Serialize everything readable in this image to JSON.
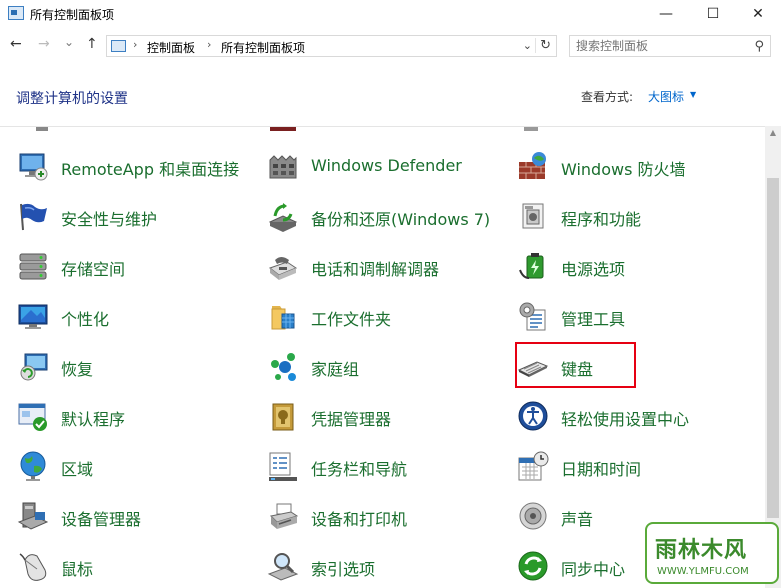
{
  "window": {
    "title": "所有控制面板项",
    "minimize": "—",
    "maximize": "☐",
    "close": "✕"
  },
  "nav": {
    "back": "←",
    "forward": "→",
    "recent": "⌄",
    "up": "↑",
    "breadcrumb": [
      "控制面板",
      "所有控制面板项"
    ],
    "crumb_sep": "›",
    "dropdown": "⌄",
    "refresh": "↻"
  },
  "search": {
    "placeholder": "搜索控制面板",
    "icon": "⚲"
  },
  "header": {
    "title": "调整计算机的设置",
    "view_label": "查看方式:",
    "view_value": "大图标",
    "view_arrow": "▼"
  },
  "items": [
    {
      "label": "RemoteApp 和桌面连接",
      "icon": "remoteapp-icon"
    },
    {
      "label": "Windows Defender",
      "icon": "windows-defender-icon"
    },
    {
      "label": "Windows 防火墙",
      "icon": "firewall-icon"
    },
    {
      "label": "安全性与维护",
      "icon": "security-flag-icon"
    },
    {
      "label": "备份和还原(Windows 7)",
      "icon": "backup-restore-icon"
    },
    {
      "label": "程序和功能",
      "icon": "programs-icon"
    },
    {
      "label": "存储空间",
      "icon": "storage-spaces-icon"
    },
    {
      "label": "电话和调制解调器",
      "icon": "phone-modem-icon"
    },
    {
      "label": "电源选项",
      "icon": "power-options-icon"
    },
    {
      "label": "个性化",
      "icon": "personalization-icon"
    },
    {
      "label": "工作文件夹",
      "icon": "work-folders-icon"
    },
    {
      "label": "管理工具",
      "icon": "admin-tools-icon"
    },
    {
      "label": "恢复",
      "icon": "recovery-icon"
    },
    {
      "label": "家庭组",
      "icon": "homegroup-icon"
    },
    {
      "label": "键盘",
      "icon": "keyboard-icon"
    },
    {
      "label": "默认程序",
      "icon": "default-programs-icon"
    },
    {
      "label": "凭据管理器",
      "icon": "credential-manager-icon"
    },
    {
      "label": "轻松使用设置中心",
      "icon": "ease-of-access-icon"
    },
    {
      "label": "区域",
      "icon": "region-globe-icon"
    },
    {
      "label": "任务栏和导航",
      "icon": "taskbar-icon"
    },
    {
      "label": "日期和时间",
      "icon": "date-time-icon"
    },
    {
      "label": "设备管理器",
      "icon": "device-manager-icon"
    },
    {
      "label": "设备和打印机",
      "icon": "devices-printers-icon"
    },
    {
      "label": "声音",
      "icon": "sound-icon"
    },
    {
      "label": "鼠标",
      "icon": "mouse-icon"
    },
    {
      "label": "索引选项",
      "icon": "indexing-icon"
    },
    {
      "label": "同步中心",
      "icon": "sync-center-icon"
    }
  ],
  "watermark": {
    "main": "雨林木风",
    "sub": "WWW.YLMFU.COM"
  },
  "colors": {
    "link_green": "#1a6e2e",
    "heading_blue": "#1e3287",
    "link_blue": "#0066cc",
    "highlight_red": "#e60012"
  }
}
